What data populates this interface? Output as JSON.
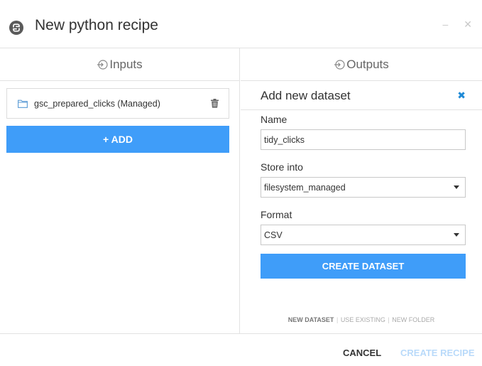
{
  "header": {
    "title": "New python recipe",
    "minimize_glyph": "–",
    "close_glyph": "✕"
  },
  "inputs": {
    "title": "Inputs",
    "items": [
      {
        "label": "gsc_prepared_clicks (Managed)"
      }
    ],
    "add_label": "+ ADD"
  },
  "outputs": {
    "title": "Outputs",
    "panel_title": "Add new dataset",
    "close_glyph": "✖",
    "name_label": "Name",
    "name_value": "tidy_clicks",
    "store_label": "Store into",
    "store_value": "filesystem_managed",
    "format_label": "Format",
    "format_value": "CSV",
    "create_dataset_label": "CREATE DATASET",
    "modes": {
      "new_dataset": "NEW DATASET",
      "use_existing": "USE EXISTING",
      "new_folder": "NEW FOLDER",
      "separator": "|"
    }
  },
  "footer": {
    "cancel_label": "CANCEL",
    "create_recipe_label": "CREATE RECIPE"
  },
  "colors": {
    "accent": "#3f9df9",
    "close_blue": "#1f8ad6",
    "disabled_text": "#b9dafa"
  }
}
